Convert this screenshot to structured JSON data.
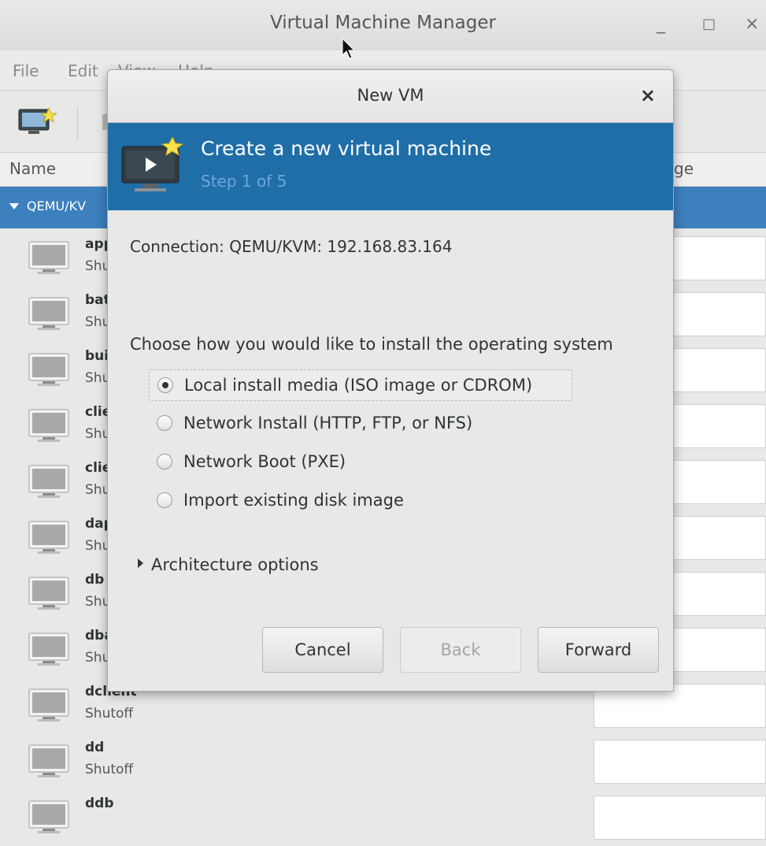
{
  "window": {
    "title": "Virtual Machine Manager",
    "minimize": "_",
    "maximize": "□",
    "close": "×"
  },
  "menubar": {
    "file": "File",
    "edit": "Edit",
    "view": "View",
    "help": "Help"
  },
  "columns": {
    "name": "Name",
    "usage": "ge"
  },
  "group": {
    "label": "QEMU/KV"
  },
  "vms": [
    {
      "name": "app",
      "status": "Shu"
    },
    {
      "name": "bat",
      "status": "Shu"
    },
    {
      "name": "bui",
      "status": "Shu"
    },
    {
      "name": "clie",
      "status": "Shu"
    },
    {
      "name": "clie",
      "status": "Shu"
    },
    {
      "name": "dap",
      "status": "Shu"
    },
    {
      "name": "db",
      "status": "Shu"
    },
    {
      "name": "dba",
      "status": "Shu"
    },
    {
      "name": "dclient",
      "status": "Shutoff"
    },
    {
      "name": "dd",
      "status": "Shutoff"
    },
    {
      "name": "ddb",
      "status": ""
    }
  ],
  "dialog": {
    "title": "New VM",
    "close": "×",
    "heading": "Create a new virtual machine",
    "step": "Step 1 of 5",
    "connection": "Connection:  QEMU/KVM: 192.168.83.164",
    "prompt": "Choose how you would like to install the operating system",
    "options": [
      {
        "label": "Local install media (ISO image or CDROM)",
        "selected": true
      },
      {
        "label": "Network Install (HTTP, FTP, or NFS)",
        "selected": false
      },
      {
        "label": "Network Boot (PXE)",
        "selected": false
      },
      {
        "label": "Import existing disk image",
        "selected": false
      }
    ],
    "expander": "Architecture options",
    "buttons": {
      "cancel": "Cancel",
      "back": "Back",
      "forward": "Forward"
    }
  },
  "colors": {
    "selection": "#3d80be",
    "banner": "#1f6ea8",
    "step_text": "#6fa6d4"
  }
}
